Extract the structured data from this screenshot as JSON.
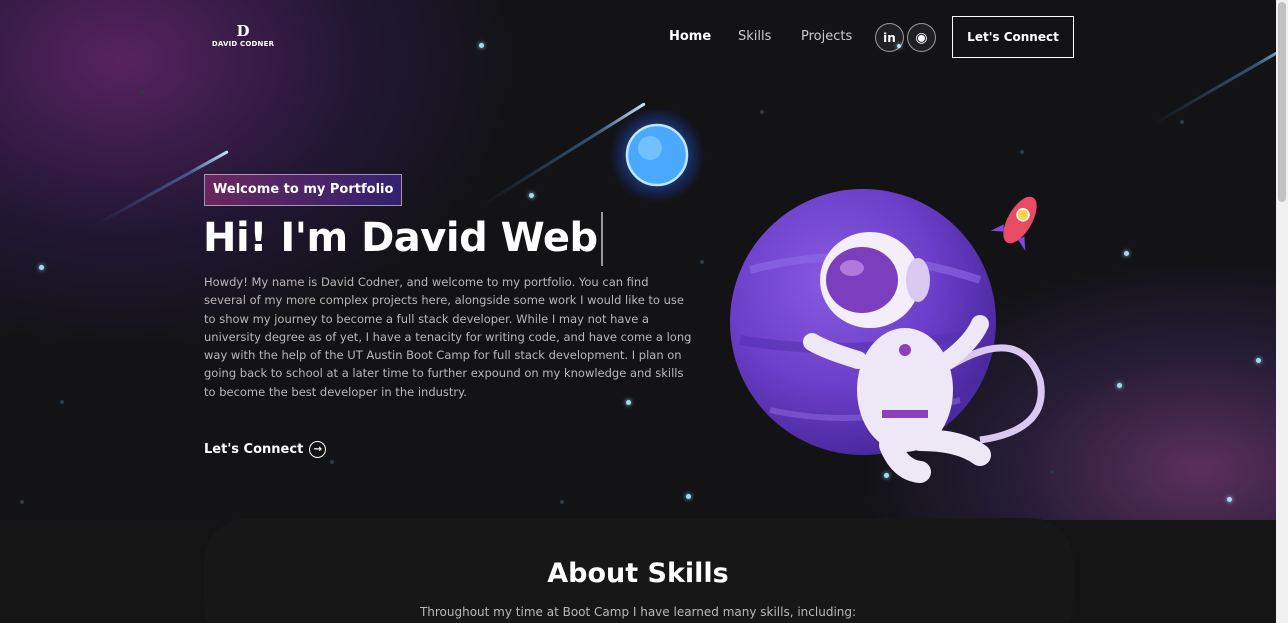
{
  "nav": {
    "logo_mark": "D",
    "logo_name": "DAVID CODNER",
    "links": [
      "Home",
      "Skills",
      "Projects"
    ],
    "social": [
      {
        "icon": "linkedin-icon",
        "glyph": "in"
      },
      {
        "icon": "github-icon",
        "glyph": "◉"
      }
    ],
    "connect_label": "Let's Connect"
  },
  "hero": {
    "tagline": "Welcome to my Portfolio",
    "title": "Hi! I'm David Web",
    "description": "Howdy! My name is David Codner, and welcome to my portfolio. You can find several of my more complex projects here, alongside some work I would like to use to show my journey to become a full stack developer. While I may not have a university degree as of yet, I have a tenacity for writing code, and have come a long way with the help of the UT Austin Boot Camp for full stack development. I plan on going back to school at a later time to further expound on my knowledge and skills to become the best developer in the industry.",
    "cta_label": "Let's Connect",
    "cta_icon": "arrow-right-circle-icon"
  },
  "skills": {
    "title": "About Skills",
    "subtitle": "Throughout my time at Boot Camp I have learned many skills, including:"
  },
  "colors": {
    "background": "#121212",
    "tag_gradient_start": "#aa367c",
    "tag_gradient_end": "#4a2fbd",
    "planet": "#6b3fc9",
    "star": "#9fdcf0"
  }
}
